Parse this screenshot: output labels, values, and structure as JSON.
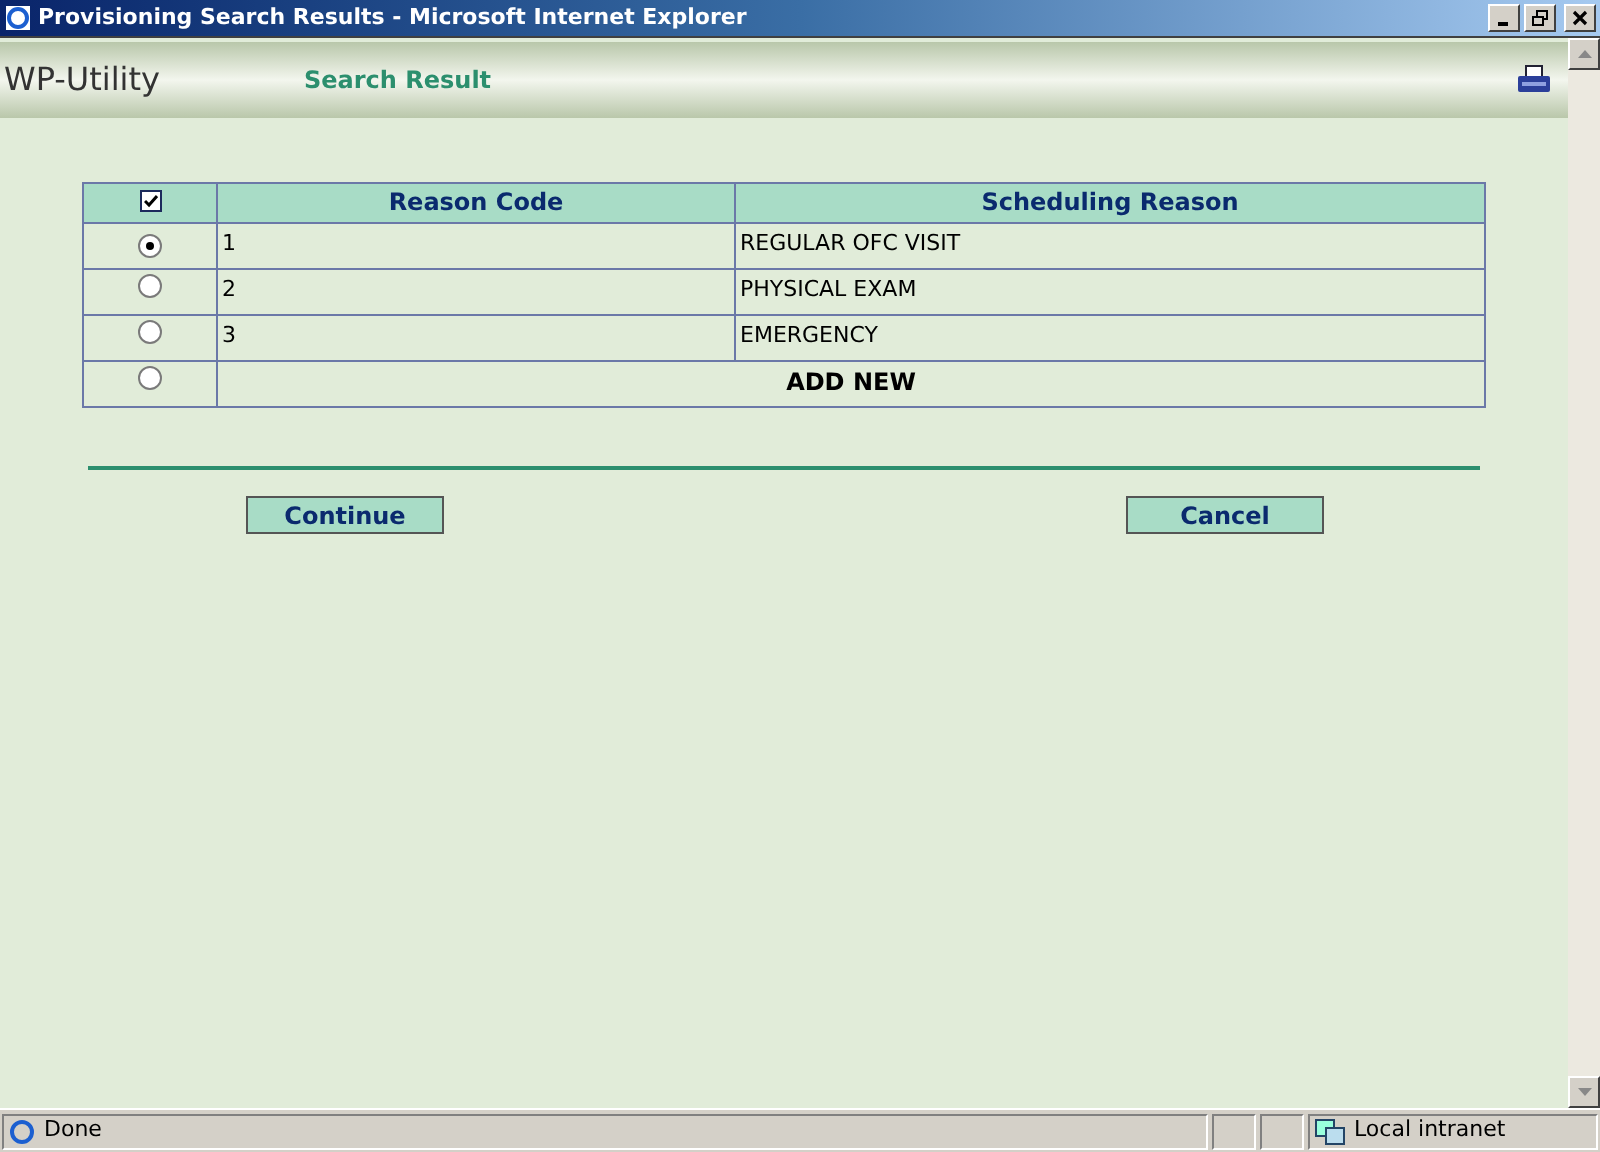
{
  "window": {
    "title": "Provisioning Search Results - Microsoft Internet Explorer"
  },
  "header": {
    "app_name": "WP-Utility",
    "page_title": "Search Result"
  },
  "table": {
    "select_all_checked": true,
    "columns": [
      "Reason Code",
      "Scheduling Reason"
    ],
    "rows": [
      {
        "kind": "data",
        "selected": true,
        "code": "1",
        "reason": "REGULAR OFC VISIT"
      },
      {
        "kind": "data",
        "selected": false,
        "code": "2",
        "reason": "PHYSICAL EXAM"
      },
      {
        "kind": "data",
        "selected": false,
        "code": "3",
        "reason": "EMERGENCY"
      },
      {
        "kind": "add",
        "selected": false,
        "label": "ADD NEW"
      }
    ]
  },
  "buttons": [
    "Continue",
    "Cancel"
  ],
  "status_bar": {
    "status": "Done",
    "zone": "Local intranet"
  }
}
